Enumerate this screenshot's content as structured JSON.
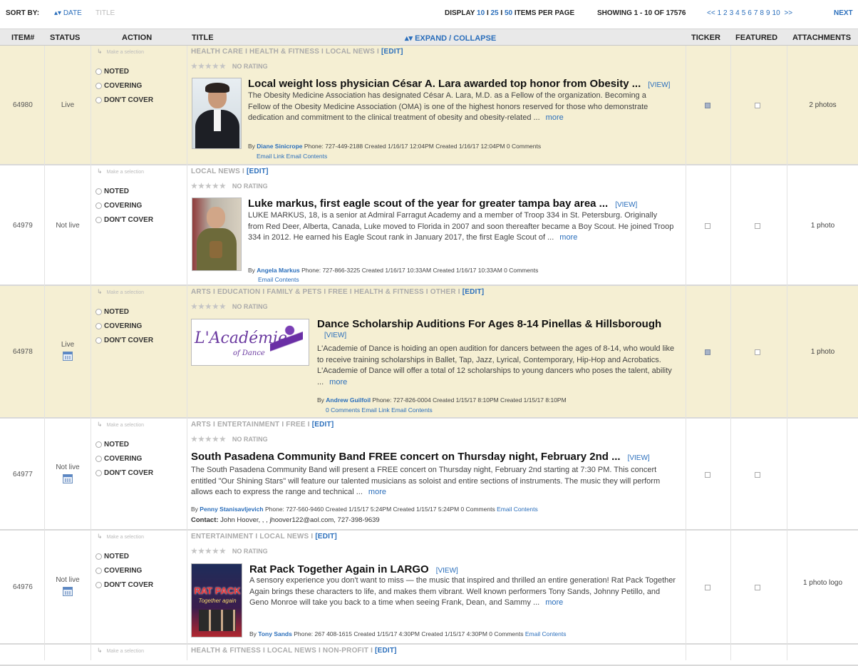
{
  "topbar": {
    "sort_by": "SORT BY:",
    "sort_arrows": "▴▾",
    "sort_date": "DATE",
    "sort_title": "TITLE",
    "display": "DISPLAY",
    "opt10": "10",
    "sep": "I",
    "opt25": "25",
    "opt50": "50",
    "per_page": "ITEMS PER PAGE",
    "showing": "SHOWING 1 - 10 OF 17576",
    "prev": "<<",
    "pages": [
      "1",
      "2",
      "3",
      "4",
      "5",
      "6",
      "7",
      "8",
      "9",
      "10"
    ],
    "next_arrows": ">>",
    "next": "NEXT"
  },
  "headers": {
    "item": "ITEM#",
    "status": "STATUS",
    "action": "ACTION",
    "title": "TITLE",
    "expand": "▴▾ EXPAND / COLLAPSE",
    "ticker": "TICKER",
    "featured": "FEATURED",
    "attachments": "ATTACHMENTS"
  },
  "action": {
    "make_selection": "Make a selection",
    "noted": "NOTED",
    "covering": "COVERING",
    "dont_cover": "DON'T COVER"
  },
  "common": {
    "no_rating": "NO RATING",
    "stars": "★★★★★",
    "view": "[VIEW]",
    "more": "more",
    "edit": "[EDIT]",
    "by": "By"
  },
  "rows": [
    {
      "item": "64980",
      "status": "Live",
      "categories": "HEALTH CARE I HEALTH & FITNESS I LOCAL NEWS I ",
      "title": "Local weight loss physician César A. Lara awarded top honor from Obesity ...",
      "excerpt": "The Obesity Medicine Association has designated César A. Lara, M.D. as a Fellow of the organization. Becoming a Fellow of the Obesity Medicine Association (OMA) is one of the highest honors reserved for those who demonstrate dedication and commitment to the clinical treatment of obesity and obesity-related ...",
      "author": "Diane Sinicrope",
      "meta": "Phone: 727-449-2188     Created 1/16/17 12:04PM     Created 1/16/17 12:04PM     0 Comments",
      "links": "Email Link   Email Contents",
      "attachments": "2 photos"
    },
    {
      "item": "64979",
      "status": "Not live",
      "categories": "LOCAL NEWS I ",
      "title": "Luke markus, first eagle scout of the year for greater tampa bay area ...",
      "excerpt": "LUKE MARKUS, 18, is a senior at Admiral Farragut Academy and a member of Troop 334 in St. Petersburg. Originally from Red Deer, Alberta, Canada, Luke moved to Florida in 2007 and soon thereafter became a Boy Scout. He joined Troop 334 in 2012. He earned his Eagle Scout rank in January 2017, the first Eagle Scout of ...",
      "author": "Angela Markus",
      "meta": "Phone: 727-866-3225     Created 1/16/17 10:33AM     Created 1/16/17 10:33AM     0 Comments",
      "links": "Email Contents",
      "attachments": "1 photo"
    },
    {
      "item": "64978",
      "status": "Live",
      "categories": "ARTS I EDUCATION I FAMILY & PETS I FREE I HEALTH & FITNESS I OTHER I ",
      "title": "Dance Scholarship Auditions For Ages 8-14 Pinellas & Hillsborough",
      "excerpt": "L'Academie of Dance is hoiding an open audition for dancers between the ages of 8-14, who would like to receive training scholarships in Ballet, Tap, Jazz, Lyrical, Contemporary, Hip-Hop and Acrobatics. L'Academie of Dance will offer a total of 12 scholarships to young dancers who poses the talent, ability ...",
      "author": "Andrew Guilfoil",
      "meta": "Phone: 727-826-0004     Created 1/15/17 8:10PM     Created 1/15/17 8:10PM",
      "links": "0 Comments   Email Link   Email Contents",
      "attachments": "1 photo",
      "logo_text": "L'Académie",
      "logo_sub": "of Dance"
    },
    {
      "item": "64977",
      "status": "Not live",
      "categories": "ARTS I ENTERTAINMENT I FREE I ",
      "title": "South Pasadena Community Band FREE concert on Thursday night, February 2nd ...",
      "excerpt": "The South Pasadena Community Band will present a FREE concert on Thursday night, February 2nd starting at 7:30 PM. This concert entitled \"Our Shining Stars\" will feature our talented musicians as soloist and entire sections of instruments. The music they will perform allows each to express the range and technical ...",
      "author": "Penny Stanisavljevich",
      "meta": "Phone: 727-560-9460     Created 1/15/17 5:24PM     Created 1/15/17 5:24PM     0 Comments",
      "links": "Email Contents",
      "contact_label": "Contact:",
      "contact": "John Hoover, , , jhoover122@aol.com, 727-398-9639",
      "attachments": ""
    },
    {
      "item": "64976",
      "status": "Not live",
      "categories": "ENTERTAINMENT I LOCAL NEWS I ",
      "title": "Rat Pack Together Again in LARGO",
      "excerpt": "A sensory experience you don't want to miss — the music that inspired and thrilled an entire generation! Rat Pack Together Again brings these characters to life, and makes them vibrant. Well known performers Tony Sands, Johnny Petillo, and Geno Monroe will take you back to a time when seeing Frank, Dean, and Sammy ...",
      "author": "Tony Sands",
      "meta": "Phone: 267 408-1615     Created 1/15/17 4:30PM     Created 1/15/17 4:30PM     0 Comments",
      "links": "Email Contents",
      "attachments": "1 photo logo",
      "poster_text": "RAT PACK",
      "poster_sub": "Together again"
    },
    {
      "item": "",
      "status": "",
      "categories": "HEALTH & FITNESS I LOCAL NEWS I NON-PROFIT I "
    }
  ]
}
